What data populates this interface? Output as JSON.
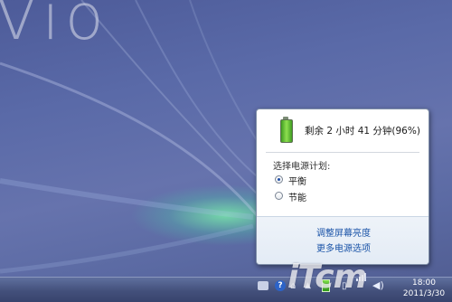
{
  "desktop": {
    "logo_text": "Vio"
  },
  "flyout": {
    "battery_status": "剩余 2 小时 41 分钟(96%)",
    "plan_heading": "选择电源计划:",
    "plans": [
      {
        "label": "平衡",
        "selected": true
      },
      {
        "label": "节能",
        "selected": false
      }
    ],
    "links": {
      "adjust_brightness": "调整屏幕亮度",
      "more_power_options": "更多电源选项"
    }
  },
  "taskbar": {
    "time": "18:00",
    "date": "2011/3/30",
    "tray_icons": [
      "keyboard-icon",
      "help-icon",
      "hardware-icon",
      "show-hidden-icons-chevron",
      "battery-icon",
      "usb-icon",
      "network-signal-icon",
      "volume-icon"
    ]
  },
  "watermark": {
    "text": "iTcm"
  },
  "colors": {
    "desktop": "#5a6aa8",
    "link": "#1b54a8",
    "battery": "#5fc331"
  }
}
